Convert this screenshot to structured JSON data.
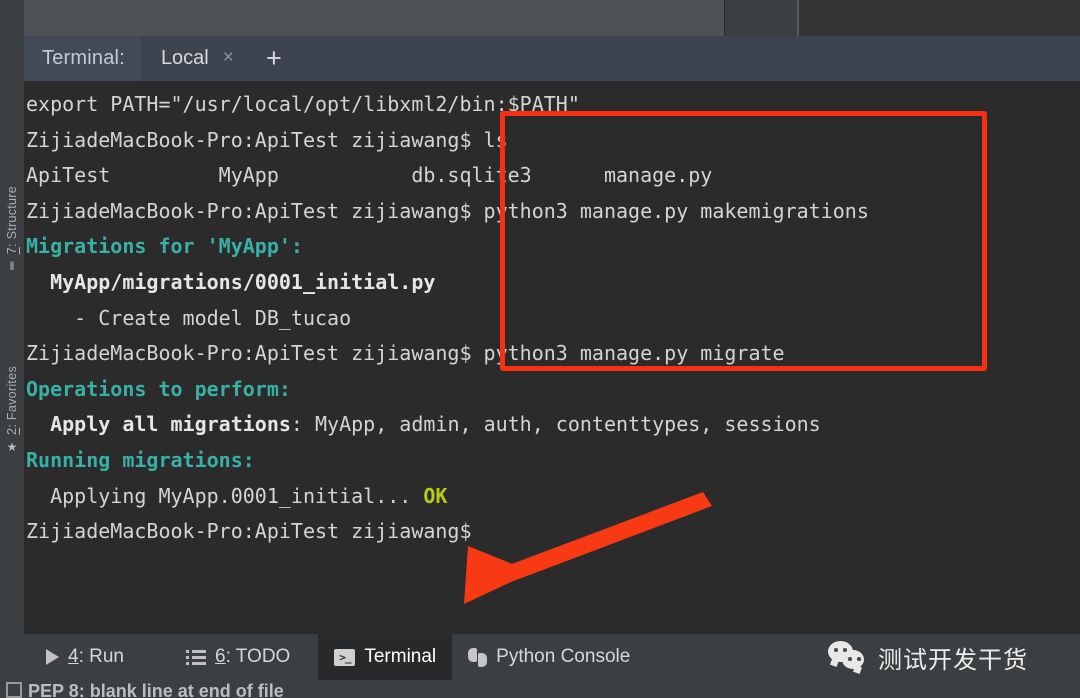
{
  "window": {
    "theme_background": "#2b2b2b",
    "accent_red": "#fa2e10",
    "accent_teal": "#39b0a5",
    "accent_ok": "#b5cc18"
  },
  "terminal_tabbar": {
    "title": "Terminal:",
    "tabs": [
      {
        "label": "Local",
        "close_icon": "×",
        "active": true
      }
    ],
    "add_label": "+"
  },
  "left_toolbar": {
    "items": [
      {
        "number": "7",
        "label": ": Structure",
        "icon": "structure-icon",
        "glyph": "‖"
      },
      {
        "number": "2",
        "label": ": Favorites",
        "icon": "star-icon",
        "glyph": "★"
      }
    ]
  },
  "terminal": {
    "lines": [
      [
        {
          "t": "export PATH=\"/usr/local/opt/libxml2/bin:$PATH\"",
          "c": "plain"
        }
      ],
      [
        {
          "t": "ZijiadeMacBook-Pro:ApiTest zijiawang$ ls",
          "c": "plain"
        }
      ],
      [
        {
          "t": "ApiTest\t\tMyApp\t\tdb.sqlite3\tmanage.py",
          "c": "plain"
        }
      ],
      [
        {
          "t": "ZijiadeMacBook-Pro:ApiTest zijiawang$ python3 manage.py makemigrations",
          "c": "plain"
        }
      ],
      [
        {
          "t": "Migrations for 'MyApp':",
          "c": "teal"
        }
      ],
      [
        {
          "t": "  MyApp/migrations/0001_initial.py",
          "c": "bold"
        }
      ],
      [
        {
          "t": "    - Create model DB_tucao",
          "c": "plain"
        }
      ],
      [
        {
          "t": "ZijiadeMacBook-Pro:ApiTest zijiawang$ python3 manage.py migrate",
          "c": "plain"
        }
      ],
      [
        {
          "t": "Operations to perform:",
          "c": "teal"
        }
      ],
      [
        {
          "t": "  Apply all migrations",
          "c": "bold"
        },
        {
          "t": ": MyApp, admin, auth, contenttypes, sessions",
          "c": "plain"
        }
      ],
      [
        {
          "t": "Running migrations:",
          "c": "teal"
        }
      ],
      [
        {
          "t": "  Applying MyApp.0001_initial... ",
          "c": "plain"
        },
        {
          "t": "OK",
          "c": "ok"
        }
      ],
      [
        {
          "t": "ZijiadeMacBook-Pro:ApiTest zijiawang$",
          "c": "plain"
        }
      ]
    ]
  },
  "annotations": {
    "highlight_box": {
      "name": "red-highlight-rectangle",
      "color": "#fa2e10"
    },
    "arrow": {
      "name": "red-pointer-arrow",
      "color": "#f83a14",
      "direction": "down-left"
    }
  },
  "bottom_toolbar": {
    "buttons": [
      {
        "key": "4",
        "label": ": Run",
        "icon": "run-triangle-icon",
        "active": false
      },
      {
        "key": "6",
        "label": ": TODO",
        "icon": "todo-list-icon",
        "active": false
      },
      {
        "key": "",
        "label": "Terminal",
        "icon": "terminal-console-icon",
        "active": true
      },
      {
        "key": "",
        "label": "Python Console",
        "icon": "python-icon",
        "active": false
      }
    ]
  },
  "status_bar": {
    "message": "PEP 8: blank line at end of file"
  },
  "watermark": {
    "icon": "wechat-icon",
    "text": "测试开发干货"
  }
}
